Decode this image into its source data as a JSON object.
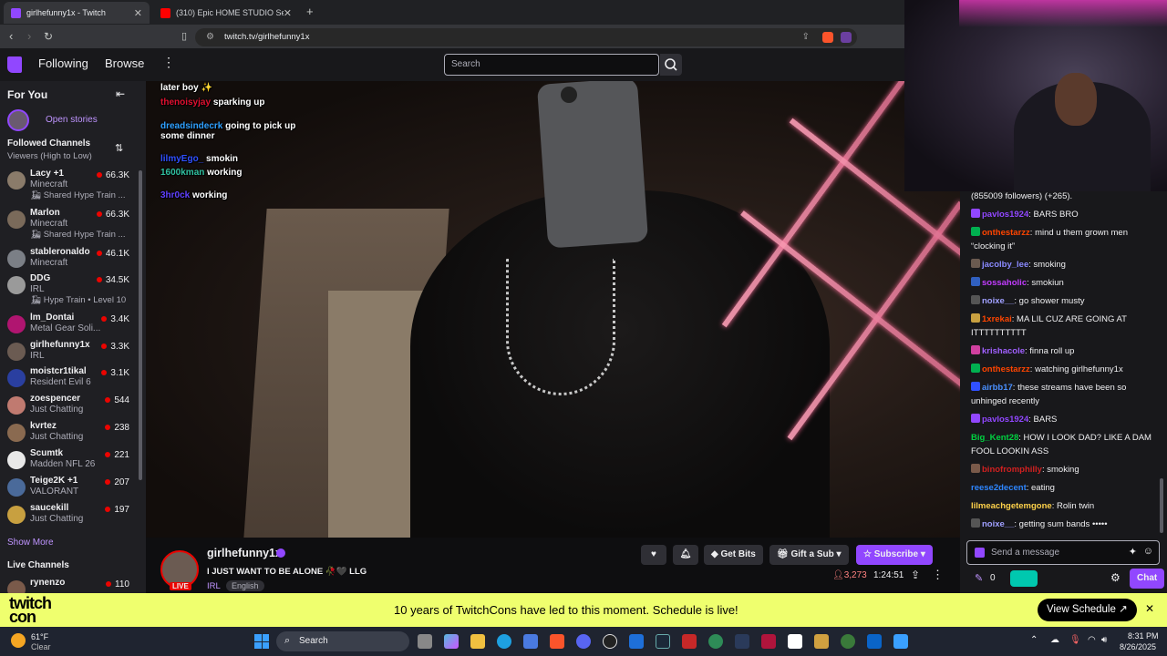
{
  "browser": {
    "tabs": [
      {
        "title": "girlhefunny1x - Twitch",
        "active": true
      },
      {
        "title": "(310) Epic HOME STUDIO Setup 2025",
        "active": false
      }
    ],
    "url": "twitch.tv/girlhefunny1x",
    "new_tab": "+"
  },
  "topnav": {
    "following": "Following",
    "browse": "Browse",
    "search_placeholder": "Search"
  },
  "sidebar": {
    "for_you": "For You",
    "open_stories": "Open stories",
    "followed_channels": "Followed Channels",
    "sort_label": "Viewers (High to Low)",
    "channels": [
      {
        "name": "Lacy +1",
        "game": "Minecraft",
        "viewers": "66.3K",
        "extra": "Shared Hype Train ...",
        "color": "#8a7b6a"
      },
      {
        "name": "Marlon",
        "game": "Minecraft",
        "viewers": "66.3K",
        "extra": "Shared Hype Train ...",
        "color": "#7a6a5a"
      },
      {
        "name": "stableronaldo",
        "game": "Minecraft",
        "viewers": "46.1K",
        "extra": "",
        "color": "#7b7f86"
      },
      {
        "name": "DDG",
        "game": "IRL",
        "viewers": "34.5K",
        "extra": "Hype Train • Level 10",
        "color": "#9a9a9a"
      },
      {
        "name": "lm_Dontai",
        "game": "Metal Gear Soli...",
        "viewers": "3.4K",
        "extra": "",
        "color": "#b01570"
      },
      {
        "name": "girlhefunny1x",
        "game": "IRL",
        "viewers": "3.3K",
        "extra": "",
        "color": "#6b5b52"
      },
      {
        "name": "moistcr1tikal",
        "game": "Resident Evil 6",
        "viewers": "3.1K",
        "extra": "",
        "color": "#2a3fa0"
      },
      {
        "name": "zoespencer",
        "game": "Just Chatting",
        "viewers": "544",
        "extra": "",
        "color": "#c07a70"
      },
      {
        "name": "kvrtez",
        "game": "Just Chatting",
        "viewers": "238",
        "extra": "",
        "color": "#8a6a50"
      },
      {
        "name": "Scumtk",
        "game": "Madden NFL 26",
        "viewers": "221",
        "extra": "",
        "color": "#e8e8e8"
      },
      {
        "name": "Teige2K +1",
        "game": "VALORANT",
        "viewers": "207",
        "extra": "",
        "color": "#4a6a9a"
      },
      {
        "name": "saucekill",
        "game": "Just Chatting",
        "viewers": "197",
        "extra": "",
        "color": "#c8a040"
      }
    ],
    "show_more": "Show More",
    "live_channels": "Live Channels",
    "live": [
      {
        "name": "rynenzo",
        "viewers": "110"
      }
    ]
  },
  "video_overlay_chat": [
    {
      "user": "",
      "text": "later boy ✨"
    },
    {
      "user": "thenoisyjay",
      "text": "sparking up"
    },
    {
      "user": "dreadsindecrk",
      "text": "going to pick up some dinner"
    },
    {
      "user": "lilmyEgo_",
      "text": "smokin"
    },
    {
      "user": "1600kman",
      "text": "working"
    },
    {
      "user": "3hr0ck",
      "text": "working"
    }
  ],
  "stream": {
    "streamer": "girlhefunny1x",
    "title": "I JUST WANT TO BE ALONE 🥀🖤 LLG",
    "category": "IRL",
    "language": "English",
    "live_badge": "LIVE",
    "viewers": "3,273",
    "uptime": "1:24:51",
    "get_bits": "Get Bits",
    "gift_sub": "Gift a Sub",
    "subscribe": "Subscribe"
  },
  "chat": {
    "first_line": "(855009 followers) (+265).",
    "messages": [
      {
        "user": "pavlos1924",
        "color": "#9147ff",
        "text": "BARS BRO"
      },
      {
        "user": "onthestarzz",
        "color": "#ff4500",
        "text": "mind u them grown men “clocking it”"
      },
      {
        "user": "jacolby_lee",
        "color": "#8a8aff",
        "text": "smoking"
      },
      {
        "user": "sossaholic",
        "color": "#c23cff",
        "text": "smokiun"
      },
      {
        "user": "noixe__",
        "color": "#a0a0ff",
        "text": "go shower musty"
      },
      {
        "user": "1xrekai",
        "color": "#ff4500",
        "text": "MA LIL CUZ ARE GOING AT ITTTTTTTTTT"
      },
      {
        "user": "krishacole",
        "color": "#a060ff",
        "text": "finna roll up"
      },
      {
        "user": "onthestarzz",
        "color": "#ff4500",
        "text": "watching girlhefunny1x"
      },
      {
        "user": "airbb17",
        "color": "#4a90ff",
        "text": "these streams have been so unhinged recently"
      },
      {
        "user": "pavlos1924",
        "color": "#9147ff",
        "text": "BARS"
      },
      {
        "user": "Big_Kent28",
        "color": "#00d040",
        "text": "HOW I LOOK DAD? LIKE A DAM FOOL LOOKIN ASS"
      },
      {
        "user": "binofromphilly",
        "color": "#d02020",
        "text": "smoking"
      },
      {
        "user": "reese2decent",
        "color": "#2e86ff",
        "text": "eating"
      },
      {
        "user": "lilmeachgetemgone",
        "color": "#ffd24a",
        "text": "Rolin twin"
      },
      {
        "user": "noixe__",
        "color": "#a0a0ff",
        "text": "getting sum bands •••••"
      }
    ],
    "input_placeholder": "Send a message",
    "points": "0",
    "chat_button": "Chat"
  },
  "banner": {
    "logo_line1": "twitch",
    "logo_line2": "con",
    "message": "10 years of TwitchCons have led to this moment. Schedule is live!",
    "cta": "View Schedule ↗"
  },
  "taskbar": {
    "weather_temp": "61°F",
    "weather_desc": "Clear",
    "search": "Search",
    "time": "8:31 PM",
    "date": "8/26/2025"
  },
  "colors": {
    "twitch_purple": "#9147ff",
    "banner_yellow": "#efff6e",
    "live_red": "#eb0400"
  }
}
